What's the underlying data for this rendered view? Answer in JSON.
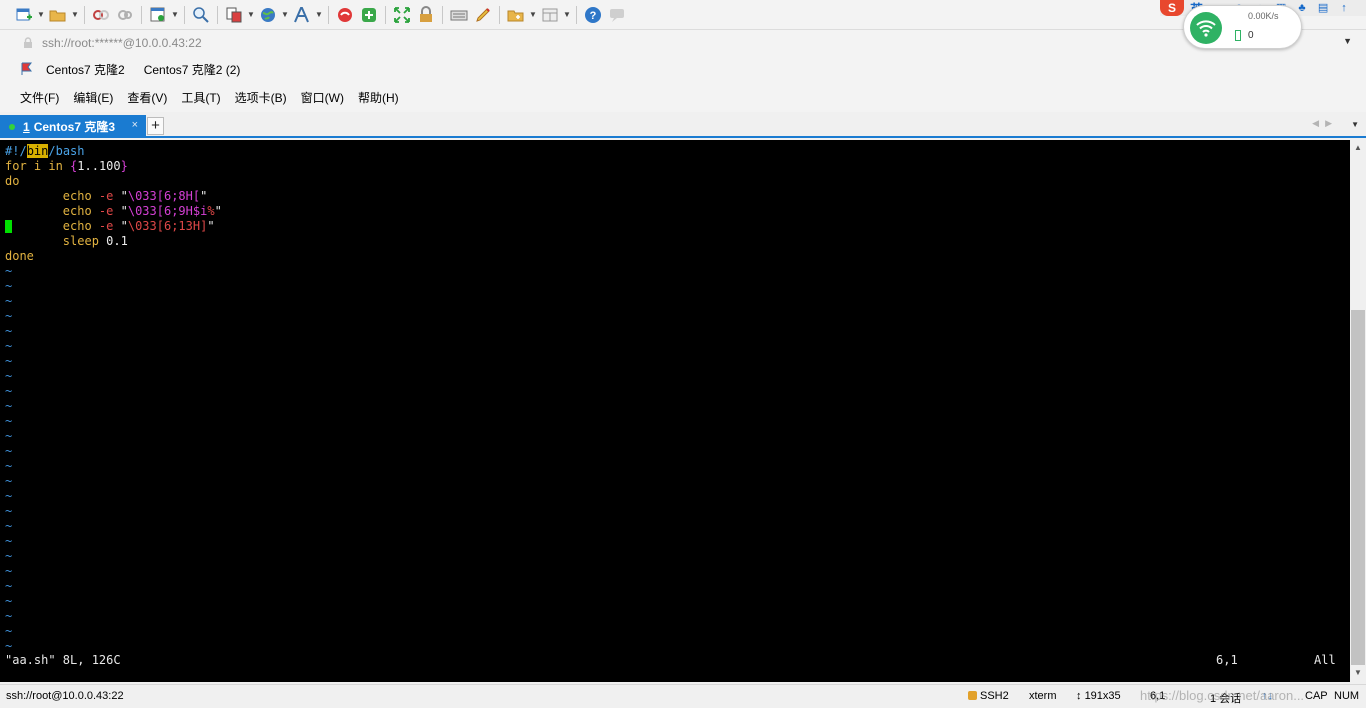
{
  "toolbar": {
    "icons": [
      "new-session-icon",
      "open-folder-icon",
      "disconnect-icon",
      "reconnect-icon",
      "properties-icon",
      "find-icon",
      "copy-paste-icon",
      "globe-icon",
      "font-icon",
      "xftp-icon",
      "xshell-green-icon",
      "fullscreen-icon",
      "lock-icon",
      "keyboard-icon",
      "highlighter-icon",
      "add-folder-icon",
      "layout-icon",
      "help-icon",
      "chat-icon"
    ]
  },
  "address": {
    "value": "ssh://root:******@10.0.0.43:22"
  },
  "sessions": {
    "items": [
      "Centos7 克隆2",
      "Centos7 克隆2 (2)"
    ]
  },
  "menu": {
    "items": [
      "文件(F)",
      "编辑(E)",
      "查看(V)",
      "工具(T)",
      "选项卡(B)",
      "窗口(W)",
      "帮助(H)"
    ]
  },
  "tab": {
    "number": "1",
    "title": "Centos7 克隆3",
    "close": "×",
    "add": "+"
  },
  "terminal": {
    "line1": {
      "a": "#!/",
      "b": "bin",
      "c": "/bash"
    },
    "line2": {
      "a": "for i in ",
      "b": "{",
      "c": "1..100",
      "d": "}"
    },
    "line3": "do",
    "line4": {
      "indent": "        ",
      "cmd": "echo ",
      "flag": "-e ",
      "q1": "\"",
      "esc": "\\033[6;8H[",
      "q2": "\""
    },
    "line5": {
      "indent": "        ",
      "cmd": "echo ",
      "flag": "-e ",
      "q1": "\"",
      "esc": "\\033[6;9H",
      "var": "$i",
      "pct": "%",
      "q2": "\""
    },
    "line6": {
      "indent": "        ",
      "cmd": "echo ",
      "flag": "-e ",
      "q1": "\"",
      "esc": "\\033[6;13H]",
      "q2": "\""
    },
    "line7": {
      "indent": "        ",
      "cmd": "sleep ",
      "num": "0.1"
    },
    "line8": "done",
    "tilde": "~",
    "status_file": "\"aa.sh\" 8L, 126C",
    "status_pos": "6,1",
    "status_all": "All"
  },
  "statusbar": {
    "connection": "ssh://root@10.0.0.43:22",
    "protocol": "SSH2",
    "term": "xterm",
    "size": "191x35",
    "cursor": "6,1",
    "sessions": "1 会话",
    "cap": "CAP",
    "num": "NUM",
    "watermark": "https://blog.csdn.net/aaron..."
  },
  "ime": {
    "logo": "S",
    "lang": "英"
  },
  "network": {
    "speed": "0.00K/s",
    "count": "0"
  }
}
